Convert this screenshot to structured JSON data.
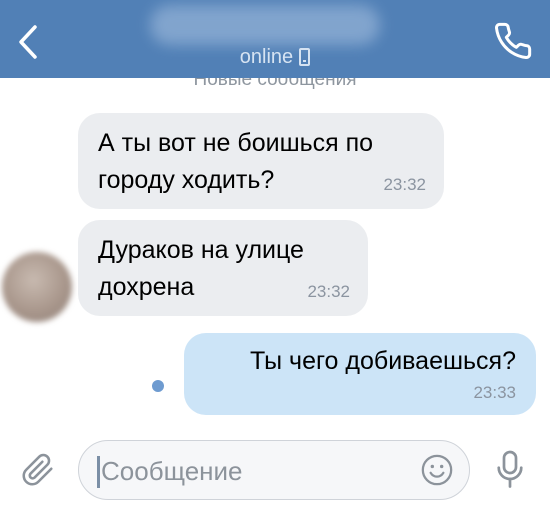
{
  "header": {
    "status": "online",
    "status_icon": "mobile-phone-icon",
    "back_icon": "chevron-left-icon",
    "call_icon": "phone-icon",
    "color": "#5180b6"
  },
  "divider": {
    "label": "Новые сообщения"
  },
  "messages": [
    {
      "direction": "incoming",
      "text": "А ты вот не боишься по\nгороду ходить?",
      "time": "23:32"
    },
    {
      "direction": "incoming",
      "text": "Дураков на улице\nдохрена",
      "time": "23:32"
    },
    {
      "direction": "outgoing",
      "text": "Ты чего добиваешься?",
      "time": "23:33"
    }
  ],
  "composer": {
    "placeholder": "Сообщение",
    "value": "",
    "attach_icon": "paperclip-icon",
    "emoji_icon": "emoji-icon",
    "mic_icon": "microphone-icon"
  },
  "colors": {
    "incoming_bubble": "#ebedf0",
    "outgoing_bubble": "#cce4f7",
    "timestamp": "#8b94a0",
    "unread_dot": "#6e9bd0"
  }
}
